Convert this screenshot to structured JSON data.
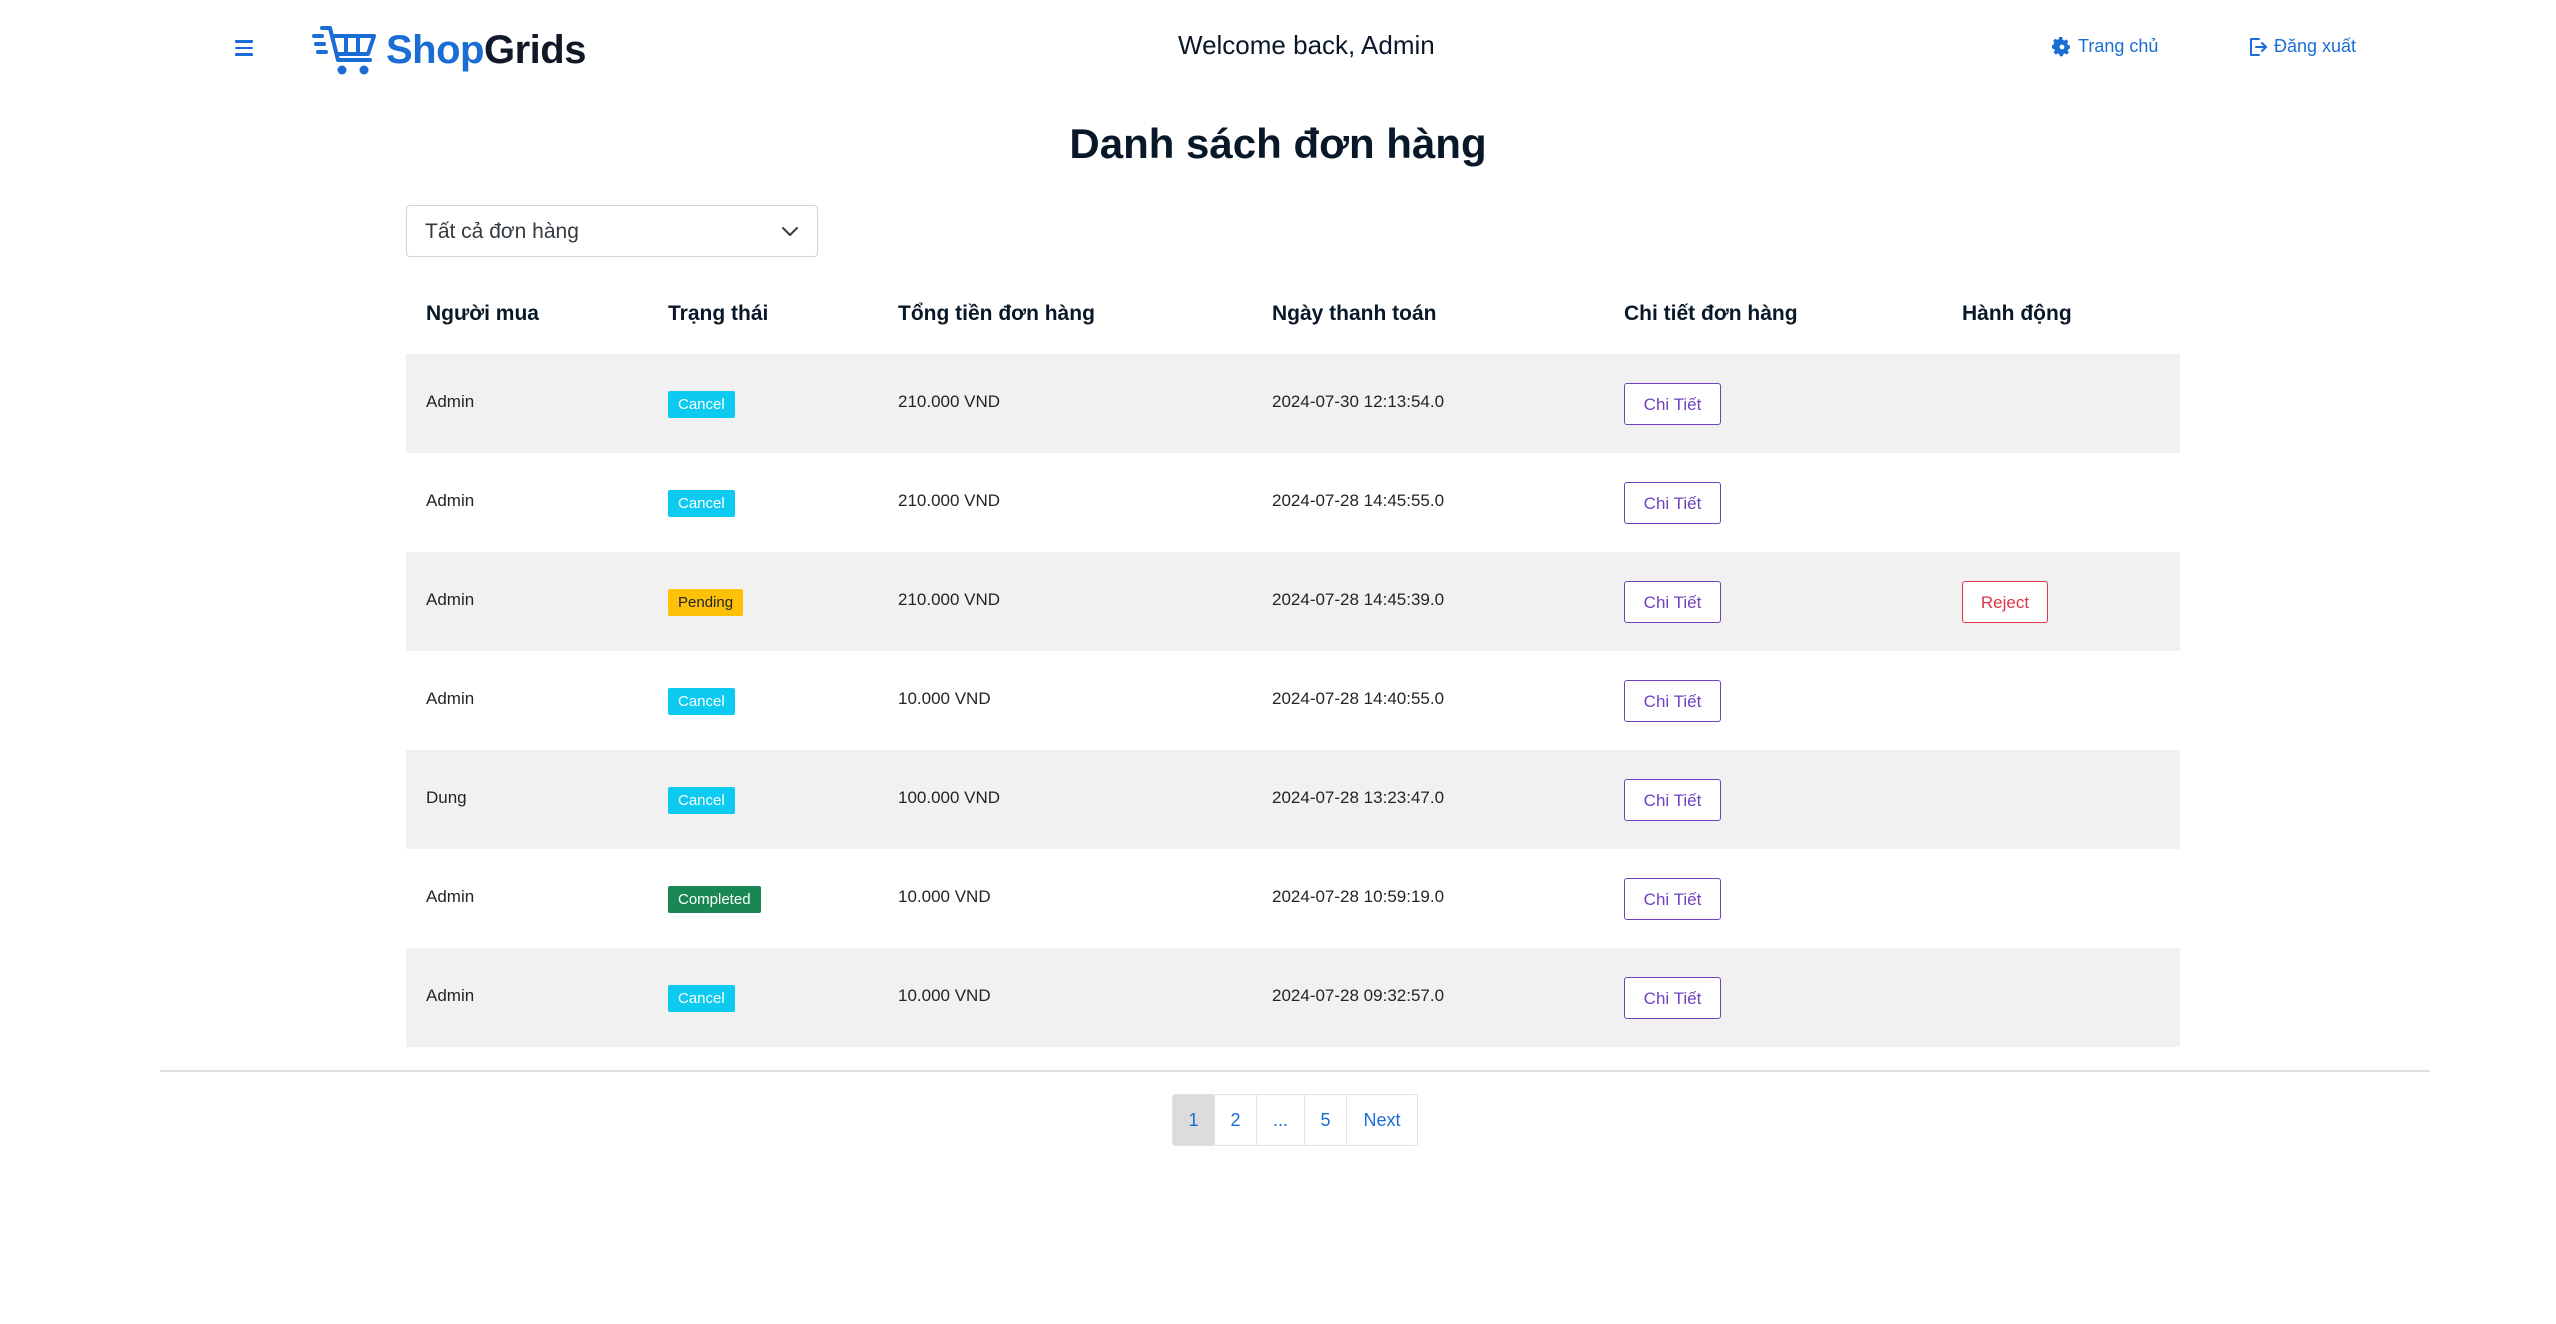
{
  "header": {
    "logo_shop": "Shop",
    "logo_grids": "Grids",
    "welcome": "Welcome back, Admin",
    "home_label": "Trang chủ",
    "logout_label": "Đăng xuất"
  },
  "page": {
    "title": "Danh sách đơn hàng"
  },
  "filter": {
    "selected": "Tất cả đơn hàng"
  },
  "table": {
    "columns": [
      "Người mua",
      "Trạng thái",
      "Tổng tiền đơn hàng",
      "Ngày thanh toán",
      "Chi tiết đơn hàng",
      "Hành động"
    ],
    "rows": [
      {
        "buyer": "Admin",
        "status": "Cancel",
        "total": "210.000 VND",
        "date": "2024-07-30 12:13:54.0",
        "detail": "Chi Tiết",
        "action": ""
      },
      {
        "buyer": "Admin",
        "status": "Cancel",
        "total": "210.000 VND",
        "date": "2024-07-28 14:45:55.0",
        "detail": "Chi Tiết",
        "action": ""
      },
      {
        "buyer": "Admin",
        "status": "Pending",
        "total": "210.000 VND",
        "date": "2024-07-28 14:45:39.0",
        "detail": "Chi Tiết",
        "action": "Reject"
      },
      {
        "buyer": "Admin",
        "status": "Cancel",
        "total": "10.000 VND",
        "date": "2024-07-28 14:40:55.0",
        "detail": "Chi Tiết",
        "action": ""
      },
      {
        "buyer": "Dung",
        "status": "Cancel",
        "total": "100.000 VND",
        "date": "2024-07-28 13:23:47.0",
        "detail": "Chi Tiết",
        "action": ""
      },
      {
        "buyer": "Admin",
        "status": "Completed",
        "total": "10.000 VND",
        "date": "2024-07-28 10:59:19.0",
        "detail": "Chi Tiết",
        "action": ""
      },
      {
        "buyer": "Admin",
        "status": "Cancel",
        "total": "10.000 VND",
        "date": "2024-07-28 09:32:57.0",
        "detail": "Chi Tiết",
        "action": ""
      }
    ]
  },
  "pagination": {
    "items": [
      "1",
      "2",
      "...",
      "5",
      "Next"
    ],
    "active": "1"
  },
  "colors": {
    "brand_blue": "#1b6dd6",
    "cancel": "#0dcaf0",
    "pending": "#ffc107",
    "completed": "#198754",
    "detail_button": "#6f42c1",
    "reject_button": "#dc3545"
  },
  "icons": {
    "menu": "hamburger-menu-icon",
    "logo": "shopping-cart-icon",
    "home": "gear-icon",
    "logout": "logout-icon",
    "dropdown": "chevron-down-icon"
  }
}
